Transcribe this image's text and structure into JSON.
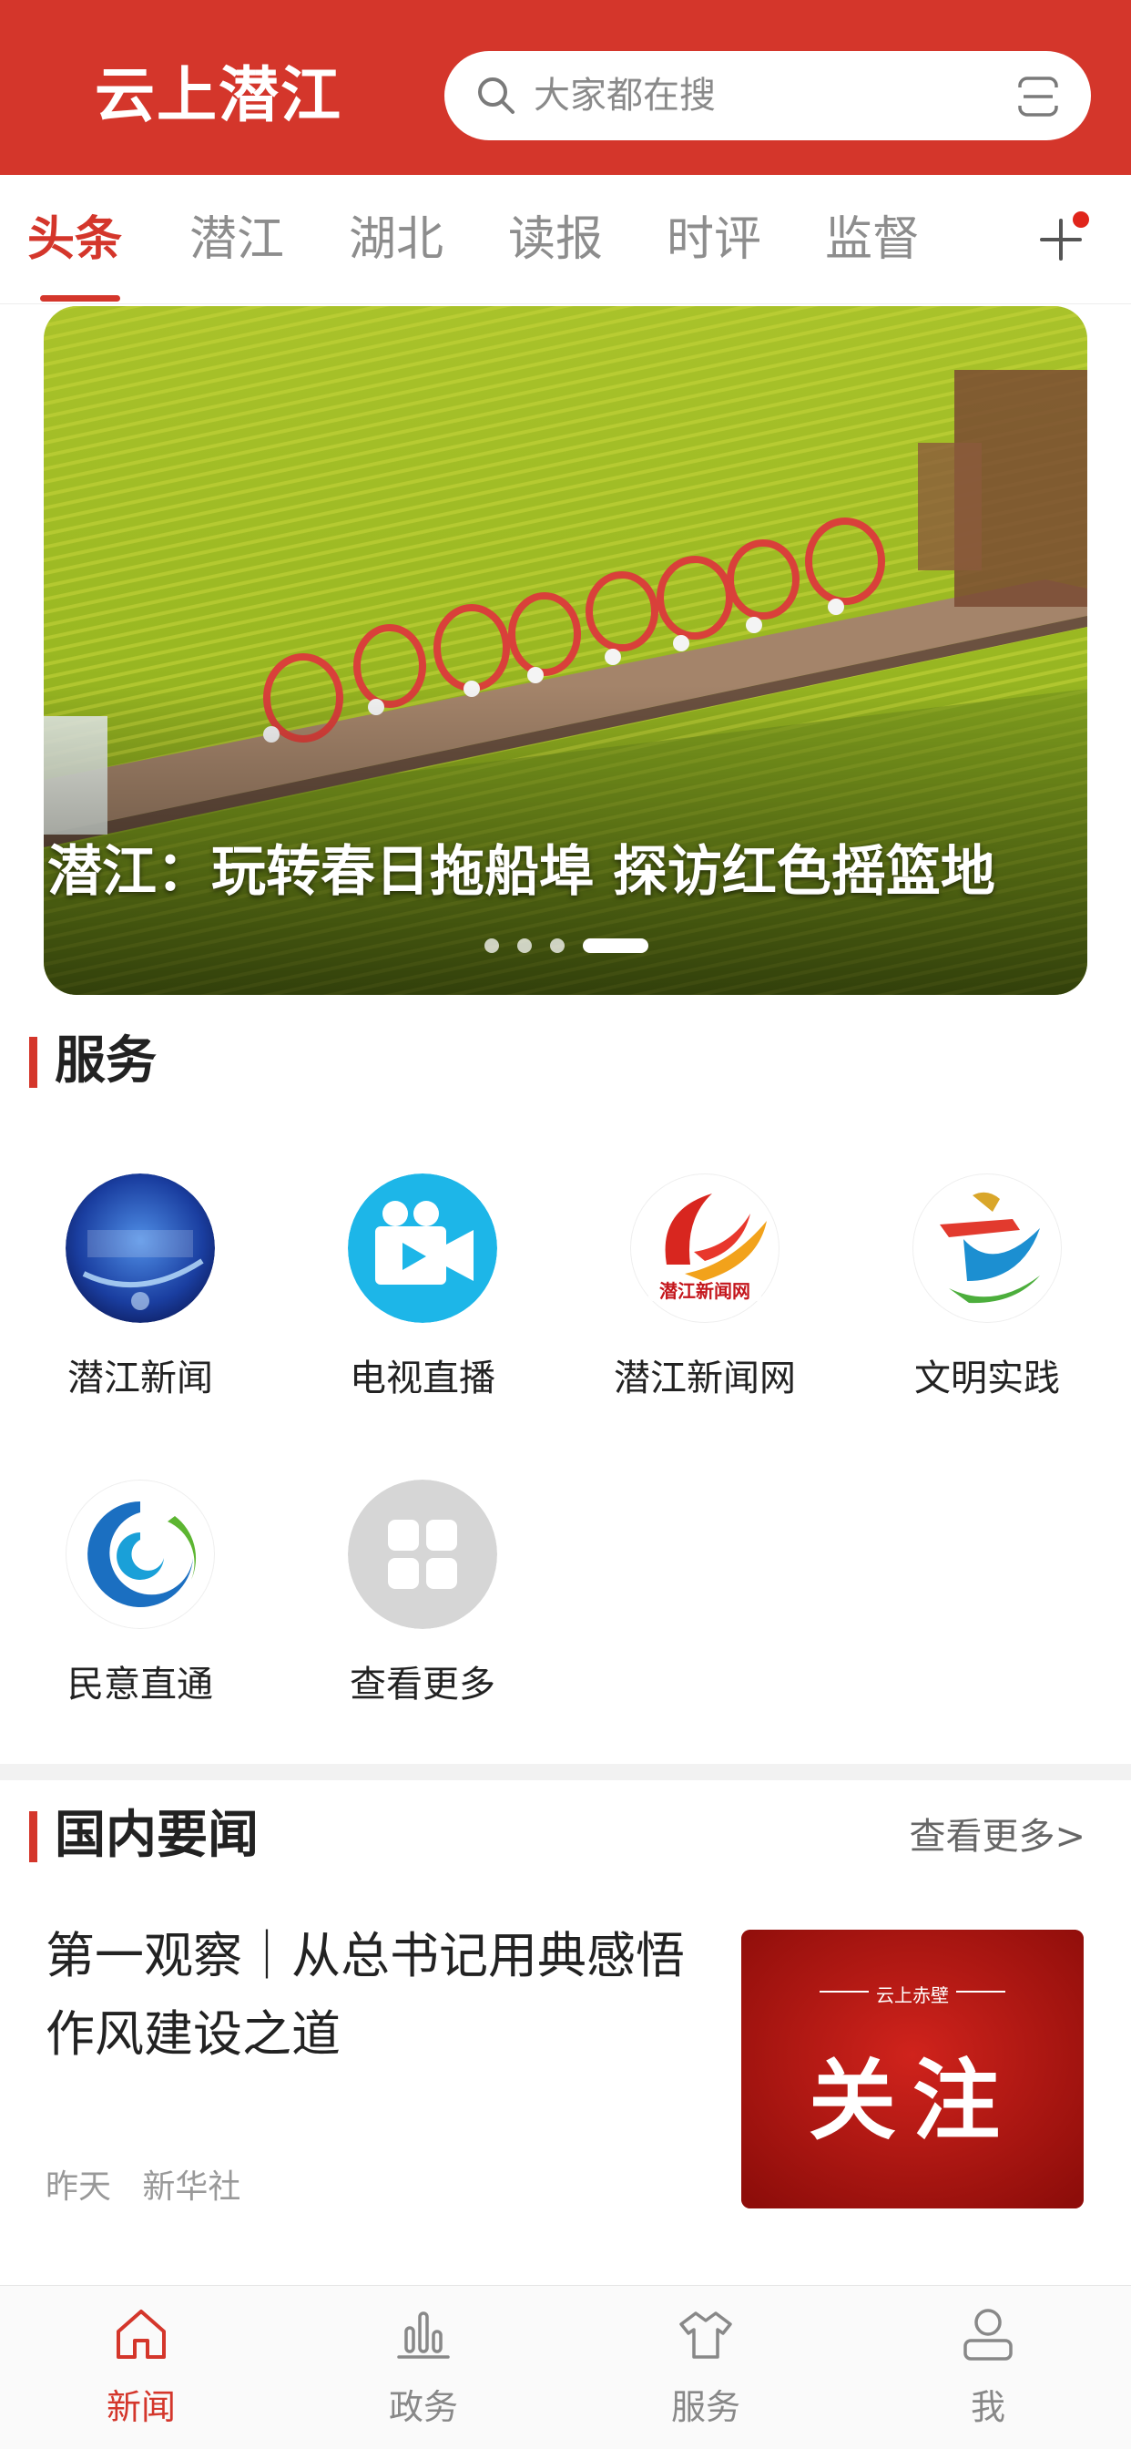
{
  "header": {
    "app_title": "云上潜江",
    "search_placeholder": "大家都在搜",
    "brand_color": "#d4362b"
  },
  "tabs": [
    {
      "label": "头条",
      "active": true
    },
    {
      "label": "潜江",
      "active": false
    },
    {
      "label": "湖北",
      "active": false
    },
    {
      "label": "读报",
      "active": false
    },
    {
      "label": "时评",
      "active": false
    },
    {
      "label": "监督",
      "active": false
    }
  ],
  "banner": {
    "title": "潜江：玩转春日拖船埠 探访红色摇篮地",
    "slide_count": 4,
    "active_slide": 4
  },
  "services": {
    "heading": "服务",
    "items": [
      {
        "label": "潜江新闻",
        "icon": "qianjiang-news-icon"
      },
      {
        "label": "电视直播",
        "icon": "tv-live-icon"
      },
      {
        "label": "潜江新闻网",
        "icon": "qianjiang-news-web-icon"
      },
      {
        "label": "文明实践",
        "icon": "civilization-practice-icon"
      },
      {
        "label": "民意直通",
        "icon": "public-opinion-icon"
      },
      {
        "label": "查看更多",
        "icon": "grid-more-icon"
      }
    ]
  },
  "domestic_news": {
    "heading": "国内要闻",
    "more_link": "查看更多>",
    "article": {
      "title": "第一观察｜从总书记用典感悟作风建设之道",
      "time": "昨天",
      "source": "新华社",
      "thumb_brand": "云上赤壁",
      "thumb_text": "关注"
    }
  },
  "bottom_nav": [
    {
      "label": "新闻",
      "icon": "home-icon",
      "active": true
    },
    {
      "label": "政务",
      "icon": "chart-icon",
      "active": false
    },
    {
      "label": "服务",
      "icon": "shirt-icon",
      "active": false
    },
    {
      "label": "我",
      "icon": "user-icon",
      "active": false
    }
  ]
}
